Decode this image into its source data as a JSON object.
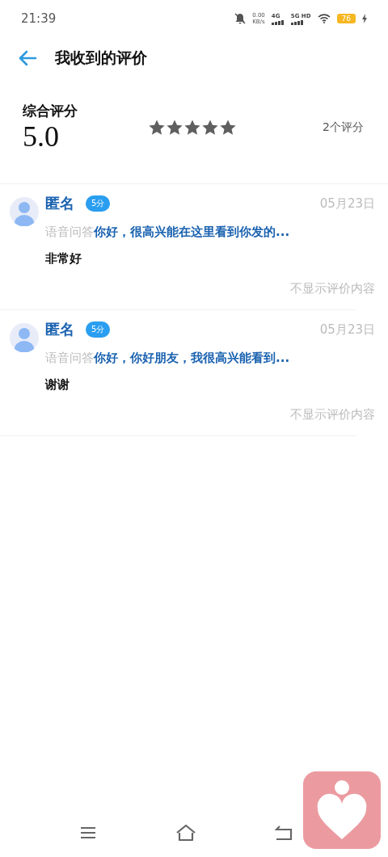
{
  "status_bar": {
    "time": "21:39",
    "speed_value": "0.00",
    "speed_unit": "KB/s",
    "network_1": "4G",
    "network_2": "5G HD",
    "battery": "76"
  },
  "header": {
    "title": "我收到的评价"
  },
  "summary": {
    "label": "综合评分",
    "score": "5.0",
    "stars": 5,
    "count": "2个评分"
  },
  "reviews": [
    {
      "name": "匿名",
      "badge": "5分",
      "date": "05月23日",
      "question_prefix": "语音问答",
      "question": "你好，很高兴能在这里看到你发的...",
      "comment": "非常好",
      "footer": "不显示评价内容"
    },
    {
      "name": "匿名",
      "badge": "5分",
      "date": "05月23日",
      "question_prefix": "语音问答",
      "question": "你好，你好朋友，我很高兴能看到...",
      "comment": "谢谢",
      "footer": "不显示评价内容"
    }
  ]
}
